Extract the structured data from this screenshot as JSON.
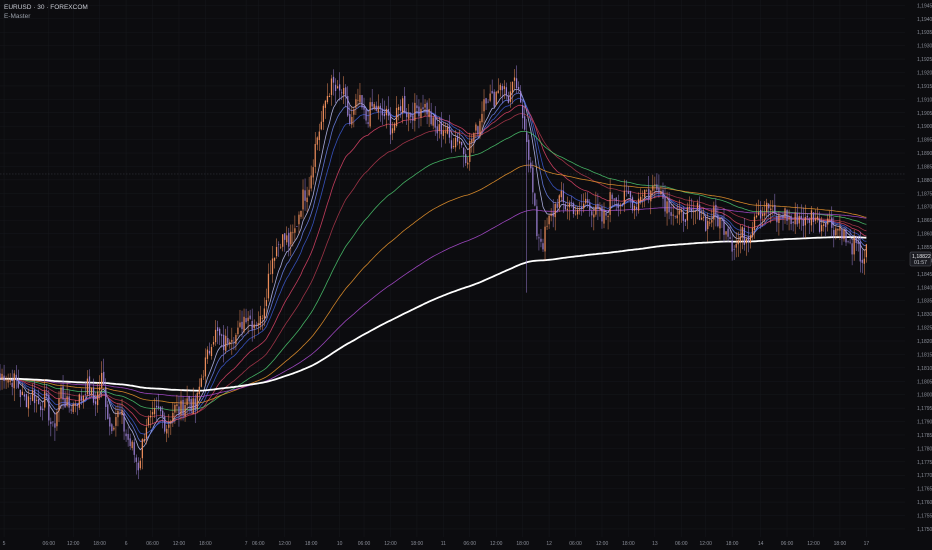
{
  "header": {
    "symbol_line": "EURUSD · 30 · FOREXCOM",
    "indicator": "E-Master"
  },
  "price_label": {
    "price": "1,18822",
    "countdown": "01:57",
    "value": 1.18822
  },
  "colors": {
    "background": "#0c0c0f",
    "candle_up": "#e98b5a",
    "candle_down": "#9a7fd1",
    "axis_text": "#8b8f99",
    "grid": "#17181d",
    "crosshair": "#3a3c44"
  },
  "chart_data": {
    "type": "candlestick",
    "timeframe": "30",
    "y_axis": {
      "position": "right",
      "ylim": [
        1.1747,
        1.1947
      ],
      "ticks": [
        1.1945,
        1.194,
        1.1935,
        1.193,
        1.1925,
        1.192,
        1.1915,
        1.191,
        1.1905,
        1.19,
        1.1895,
        1.189,
        1.1885,
        1.188,
        1.1875,
        1.187,
        1.1865,
        1.186,
        1.1855,
        1.185,
        1.1845,
        1.184,
        1.1835,
        1.183,
        1.1825,
        1.182,
        1.1815,
        1.181,
        1.1805,
        1.18,
        1.1795,
        1.179,
        1.1785,
        1.178,
        1.1775,
        1.177,
        1.1765,
        1.176,
        1.1755,
        1.175
      ],
      "tick_labels": [
        "1,19450",
        "1,19400",
        "1,19350",
        "1,19300",
        "1,19250",
        "1,19200",
        "1,19150",
        "1,19100",
        "1,19050",
        "1,19000",
        "1,18950",
        "1,18900",
        "1,18850",
        "1,18800",
        "1,18750",
        "1,18700",
        "1,18650",
        "1,18600",
        "1,18550",
        "1,18500",
        "1,18450",
        "1,18400",
        "1,18350",
        "1,18300",
        "1,18250",
        "1,18200",
        "1,18150",
        "1,18100",
        "1,18050",
        "1,18000",
        "1,17950",
        "1,17900",
        "1,17850",
        "1,17800",
        "1,17750",
        "1,17700",
        "1,17650",
        "1,17600",
        "1,17550",
        "1,17500"
      ]
    },
    "x_axis": {
      "xlim": [
        0,
        445
      ],
      "ticks": [
        {
          "bar": 2,
          "label": "5"
        },
        {
          "bar": 24,
          "label": "06:00"
        },
        {
          "bar": 36,
          "label": "12:00"
        },
        {
          "bar": 49,
          "label": "18:00"
        },
        {
          "bar": 62,
          "label": "6"
        },
        {
          "bar": 75,
          "label": "06:00"
        },
        {
          "bar": 88,
          "label": "12:00"
        },
        {
          "bar": 101,
          "label": "18:00"
        },
        {
          "bar": 121,
          "label": "7"
        },
        {
          "bar": 127,
          "label": "06:00"
        },
        {
          "bar": 140,
          "label": "12:00"
        },
        {
          "bar": 153,
          "label": "18:00"
        },
        {
          "bar": 167,
          "label": "10"
        },
        {
          "bar": 179,
          "label": "06:00"
        },
        {
          "bar": 192,
          "label": "12:00"
        },
        {
          "bar": 205,
          "label": "18:00"
        },
        {
          "bar": 218,
          "label": "11"
        },
        {
          "bar": 231,
          "label": "06:00"
        },
        {
          "bar": 244,
          "label": "12:00"
        },
        {
          "bar": 257,
          "label": "18:00"
        },
        {
          "bar": 270,
          "label": "12"
        },
        {
          "bar": 283,
          "label": "06:00"
        },
        {
          "bar": 296,
          "label": "12:00"
        },
        {
          "bar": 309,
          "label": "18:00"
        },
        {
          "bar": 322,
          "label": "13"
        },
        {
          "bar": 335,
          "label": "06:00"
        },
        {
          "bar": 347,
          "label": "12:00"
        },
        {
          "bar": 360,
          "label": "18:00"
        },
        {
          "bar": 374,
          "label": "14"
        },
        {
          "bar": 387,
          "label": "06:00"
        },
        {
          "bar": 400,
          "label": "12:00"
        },
        {
          "bar": 413,
          "label": "18:00"
        },
        {
          "bar": 426,
          "label": "17"
        }
      ]
    },
    "price_anchors": [
      [
        0,
        1.1806
      ],
      [
        6,
        1.1807
      ],
      [
        10,
        1.18
      ],
      [
        16,
        1.1799
      ],
      [
        22,
        1.1797
      ],
      [
        26,
        1.1788
      ],
      [
        30,
        1.18
      ],
      [
        36,
        1.1795
      ],
      [
        42,
        1.1803
      ],
      [
        46,
        1.1798
      ],
      [
        50,
        1.1805
      ],
      [
        54,
        1.179
      ],
      [
        60,
        1.1792
      ],
      [
        64,
        1.178
      ],
      [
        68,
        1.1775
      ],
      [
        72,
        1.1788
      ],
      [
        76,
        1.1793
      ],
      [
        82,
        1.179
      ],
      [
        90,
        1.1797
      ],
      [
        96,
        1.1796
      ],
      [
        100,
        1.1808
      ],
      [
        104,
        1.1822
      ],
      [
        110,
        1.182
      ],
      [
        116,
        1.1823
      ],
      [
        122,
        1.183
      ],
      [
        128,
        1.1826
      ],
      [
        132,
        1.1845
      ],
      [
        138,
        1.186
      ],
      [
        142,
        1.1855
      ],
      [
        148,
        1.187
      ],
      [
        152,
        1.188
      ],
      [
        156,
        1.1895
      ],
      [
        160,
        1.191
      ],
      [
        164,
        1.1915
      ],
      [
        168,
        1.1912
      ],
      [
        172,
        1.1902
      ],
      [
        176,
        1.1908
      ],
      [
        180,
        1.1904
      ],
      [
        186,
        1.1907
      ],
      [
        192,
        1.19
      ],
      [
        198,
        1.1908
      ],
      [
        204,
        1.1904
      ],
      [
        208,
        1.191
      ],
      [
        212,
        1.1901
      ],
      [
        216,
        1.1899
      ],
      [
        220,
        1.1897
      ],
      [
        226,
        1.1894
      ],
      [
        230,
        1.189
      ],
      [
        234,
        1.1898
      ],
      [
        238,
        1.191
      ],
      [
        242,
        1.1911
      ],
      [
        246,
        1.1915
      ],
      [
        250,
        1.1912
      ],
      [
        254,
        1.1914
      ],
      [
        258,
        1.1902
      ],
      [
        262,
        1.1875
      ],
      [
        264,
        1.1862
      ],
      [
        267,
        1.1855
      ],
      [
        270,
        1.1866
      ],
      [
        276,
        1.1873
      ],
      [
        280,
        1.187
      ],
      [
        284,
        1.1868
      ],
      [
        290,
        1.1872
      ],
      [
        296,
        1.1864
      ],
      [
        300,
        1.1873
      ],
      [
        306,
        1.1873
      ],
      [
        312,
        1.1872
      ],
      [
        318,
        1.1876
      ],
      [
        324,
        1.1878
      ],
      [
        330,
        1.1868
      ],
      [
        336,
        1.1866
      ],
      [
        342,
        1.1868
      ],
      [
        348,
        1.1865
      ],
      [
        354,
        1.1866
      ],
      [
        360,
        1.1857
      ],
      [
        366,
        1.1858
      ],
      [
        372,
        1.1868
      ],
      [
        376,
        1.187
      ],
      [
        380,
        1.1867
      ],
      [
        386,
        1.1866
      ],
      [
        392,
        1.1865
      ],
      [
        398,
        1.1866
      ],
      [
        404,
        1.1865
      ],
      [
        410,
        1.1864
      ],
      [
        414,
        1.186
      ],
      [
        418,
        1.1856
      ],
      [
        421,
        1.1853
      ],
      [
        424,
        1.1852
      ],
      [
        426,
        1.1853
      ]
    ],
    "moving_averages": [
      {
        "period": 9,
        "color": "#c6c9ff"
      },
      {
        "period": 14,
        "color": "#6f86f0"
      },
      {
        "period": 21,
        "color": "#3d5cd6"
      },
      {
        "period": 34,
        "color": "#e0456a"
      },
      {
        "period": 55,
        "color": "#b3394f"
      },
      {
        "period": 89,
        "color": "#4ecb71"
      },
      {
        "period": 144,
        "color": "#f29a2e"
      },
      {
        "period": 233,
        "color": "#b14fd8"
      },
      {
        "period": 400,
        "color": "#ffffff",
        "thick": true
      }
    ],
    "wide_wick": {
      "bar": 259,
      "low": 1.1838
    }
  }
}
